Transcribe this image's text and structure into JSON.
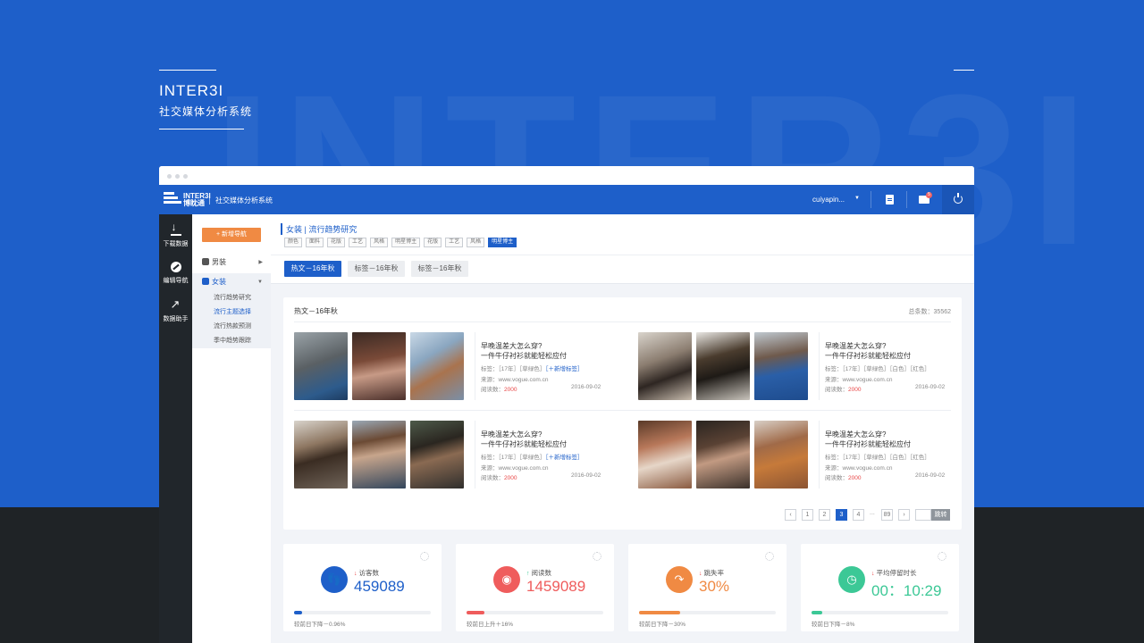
{
  "banner": {
    "bg_word": "INTER3I",
    "brand_name": "INTER3I",
    "brand_subtitle": "社交媒体分析系统"
  },
  "appbar": {
    "logo_top": "INTER3I",
    "logo_bottom": "博眈通",
    "app_title": "社交媒体分析系统",
    "username": "cuiyapin...",
    "mail_badge": "5",
    "colors": {
      "primary": "#1e5fc9",
      "accent": "#f08a43",
      "rail": "#21262b"
    }
  },
  "rail": [
    {
      "label": "下载数据",
      "icon": "download-icon"
    },
    {
      "label": "编辑导航",
      "icon": "edit-icon"
    },
    {
      "label": "数据助手",
      "icon": "chart-icon"
    }
  ],
  "nav": {
    "new_button": "+ 新增导航",
    "sections": [
      {
        "label": "男装",
        "expanded": false
      },
      {
        "label": "女装",
        "expanded": true
      }
    ],
    "women_items": [
      "流行趋势研究",
      "流行主题选择",
      "流行热款预测",
      "季中趋势跟踪"
    ],
    "active_item": "流行主题选择"
  },
  "breadcrumb": {
    "category": "女装",
    "page": "流行趋势研究"
  },
  "tags": [
    "颜色",
    "面料",
    "花版",
    "工艺",
    "风格",
    "明星博主",
    "花版",
    "工艺",
    "风格",
    "明星博主"
  ],
  "active_tag_index": 9,
  "tabs": [
    "热文－16年秋",
    "标签－16年秋",
    "标签－16年秋"
  ],
  "article_list": {
    "title": "热文－16年秋",
    "total_label": "总条数：",
    "total": "35562",
    "posts": [
      {
        "title_line1": "早晚温差大怎么穿?",
        "title_line2": "一件牛仔衬衫就能轻松应付",
        "tags_text": "标签：［17年］［草绿色］",
        "add_tag": "［＋新增标签］",
        "source": "来源：www.vogue.com.cn",
        "reads_label": "阅读数：",
        "reads": "2000",
        "date": "2016-09-02"
      },
      {
        "title_line1": "早晚温差大怎么穿?",
        "title_line2": "一件牛仔衬衫就能轻松应付",
        "tags_text": "标签：［17年］［草绿色］［白色］［红色］",
        "add_tag": "",
        "source": "来源：www.vogue.com.cn",
        "reads_label": "阅读数：",
        "reads": "2000",
        "date": "2016-09-02"
      },
      {
        "title_line1": "早晚温差大怎么穿?",
        "title_line2": "一件牛仔衬衫就能轻松应付",
        "tags_text": "标签：［17年］［草绿色］",
        "add_tag": "［＋新增标签］",
        "source": "来源：www.vogue.com.cn",
        "reads_label": "阅读数：",
        "reads": "2000",
        "date": "2016-09-02"
      },
      {
        "title_line1": "早晚温差大怎么穿?",
        "title_line2": "一件牛仔衬衫就能轻松应付",
        "tags_text": "标签：［17年］［草绿色］［白色］［红色］",
        "add_tag": "",
        "source": "来源：www.vogue.com.cn",
        "reads_label": "阅读数：",
        "reads": "2000",
        "date": "2016-09-02"
      }
    ]
  },
  "pagination": {
    "prev": "‹",
    "pages": [
      "1",
      "2",
      "3",
      "4"
    ],
    "current": "3",
    "ellipsis": "...",
    "last": "89",
    "next": "›",
    "jump_button": "跳转"
  },
  "stats": [
    {
      "label": "访客数",
      "trend": "down",
      "arrow": "↓",
      "value": "459089",
      "footer": "较前日下降－0.96%",
      "color": "#1e5fc9",
      "progress": 0.06,
      "icon": "footprint-icon"
    },
    {
      "label": "阅读数",
      "trend": "up",
      "arrow": "↑",
      "value": "1459089",
      "footer": "较前日上升＋16%",
      "color": "#ef5c5c",
      "progress": 0.13,
      "icon": "eye-icon"
    },
    {
      "label": "跳失率",
      "trend": "down",
      "arrow": "↓",
      "value": "30%",
      "footer": "较前日下降－30%",
      "color": "#f08a43",
      "progress": 0.3,
      "icon": "bounce-icon"
    },
    {
      "label": "平均停留时长",
      "trend": "down",
      "arrow": "↓",
      "value": "00：10:29",
      "footer": "较前日下降－8%",
      "color": "#3cc896",
      "progress": 0.08,
      "icon": "clock-icon"
    }
  ]
}
